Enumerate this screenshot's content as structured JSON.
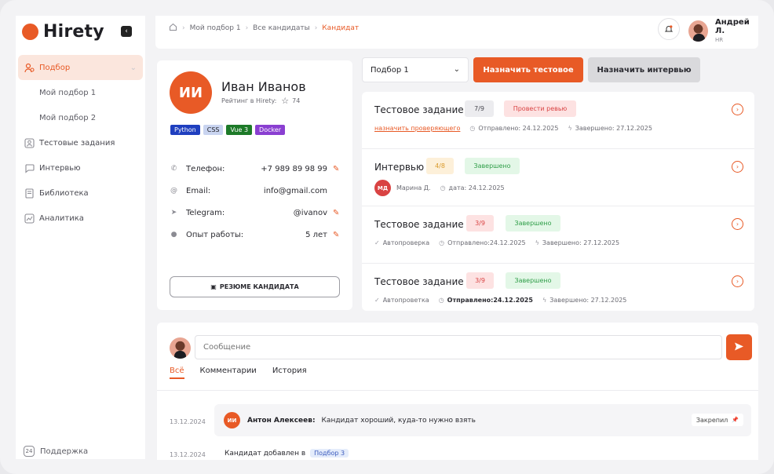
{
  "brand": {
    "name": "Hirety",
    "color": "#e85a26"
  },
  "sidebar": {
    "items": [
      {
        "label": "Подбор",
        "icon": "users-icon",
        "active": true
      },
      {
        "label": "Мой подбор 1",
        "sub": true
      },
      {
        "label": "Мой подбор 2",
        "sub": true
      },
      {
        "label": "Тестовые задания",
        "icon": "task-icon"
      },
      {
        "label": "Интервью",
        "icon": "chat-icon"
      },
      {
        "label": "Библиотека",
        "icon": "book-icon"
      },
      {
        "label": "Аналитика",
        "icon": "chart-icon"
      }
    ],
    "support": {
      "label": "Поддержка",
      "icon_text": "24"
    }
  },
  "breadcrumb": {
    "items": [
      "Мой подбор 1",
      "Все кандидаты"
    ],
    "current": "Кандидат"
  },
  "user": {
    "name": "Андрей Л.",
    "role": "HR"
  },
  "candidate": {
    "initials": "ИИ",
    "name": "Иван Иванов",
    "rating_label": "Рейтинг в Hirety:",
    "rating_value": "74",
    "tags": [
      {
        "label": "Python",
        "bg": "#1f3fbf",
        "fg": "#ffffff"
      },
      {
        "label": "CSS",
        "bg": "#c9d4f0",
        "fg": "#1f1f24"
      },
      {
        "label": "Vue 3",
        "bg": "#1d7a28",
        "fg": "#ffffff"
      },
      {
        "label": "Docker",
        "bg": "#8a3fd1",
        "fg": "#ffffff"
      }
    ],
    "info": [
      {
        "label": "Телефон:",
        "value": "+7 989 89 98 99",
        "icon": "phone-icon",
        "editable": true
      },
      {
        "label": "Email:",
        "value": "info@gmail.com",
        "icon": "at-icon",
        "editable": false
      },
      {
        "label": "Telegram:",
        "value": "@ivanov",
        "icon": "telegram-icon",
        "editable": true
      },
      {
        "label": "Опыт работы:",
        "value": "5 лет",
        "icon": "person-icon",
        "editable": true
      }
    ],
    "resume_label": "РЕЗЮМЕ КАНДИДАТА"
  },
  "actions": {
    "selection_value": "Подбор 1",
    "assign_test": "Назначить тестовое",
    "assign_interview": "Назначить интервью"
  },
  "tasks": [
    {
      "title": "Тестовое задание 1",
      "score": "7/9",
      "score_bg": "#ececef",
      "score_fg": "#4a4a52",
      "status": "Провести ревью",
      "status_bg": "#fde2e2",
      "status_fg": "#d94343",
      "assign_link": "назначить проверяющего",
      "sent": "Отправлено: 24.12.2025",
      "done": "Завершено: 27.12.2025"
    },
    {
      "title": "Интервью",
      "score": "4/8",
      "score_bg": "#fdf0d9",
      "score_fg": "#d99a2b",
      "status": "Завершено",
      "status_bg": "#e3f7e7",
      "status_fg": "#2f9e48",
      "reviewer_initials": "МД",
      "reviewer": "Марина Д.",
      "date": "дата: 24.12.2025"
    },
    {
      "title": "Тестовое задание 3",
      "score": "3/9",
      "score_bg": "#fde2e2",
      "score_fg": "#d94343",
      "status": "Завершено",
      "status_bg": "#e3f7e7",
      "status_fg": "#2f9e48",
      "check": "Автопроверка",
      "sent": "Отправлено:24.12.2025",
      "done": "Завершено: 27.12.2025"
    },
    {
      "title": "Тестовое задание 4",
      "score": "3/9",
      "score_bg": "#fde2e2",
      "score_fg": "#d94343",
      "status": "Завершено",
      "status_bg": "#e3f7e7",
      "status_fg": "#2f9e48",
      "check": "Автопроветка",
      "sent": "Отправлено:24.12.2025",
      "done": "Завершено: 27.12.2025"
    }
  ],
  "messages": {
    "placeholder": "Сообщение",
    "tabs": [
      "Всё",
      "Комментарии",
      "История"
    ],
    "comment": {
      "date": "13.12.2024",
      "initials": "ИИ",
      "author": "Антон Алексеев:",
      "text": "Кандидат хороший, куда-то нужно взять",
      "pinned": "Закрепил"
    },
    "history": {
      "date": "13.12.2024",
      "text": "Кандидат добавлен в",
      "badge": "Подбор 3"
    }
  }
}
